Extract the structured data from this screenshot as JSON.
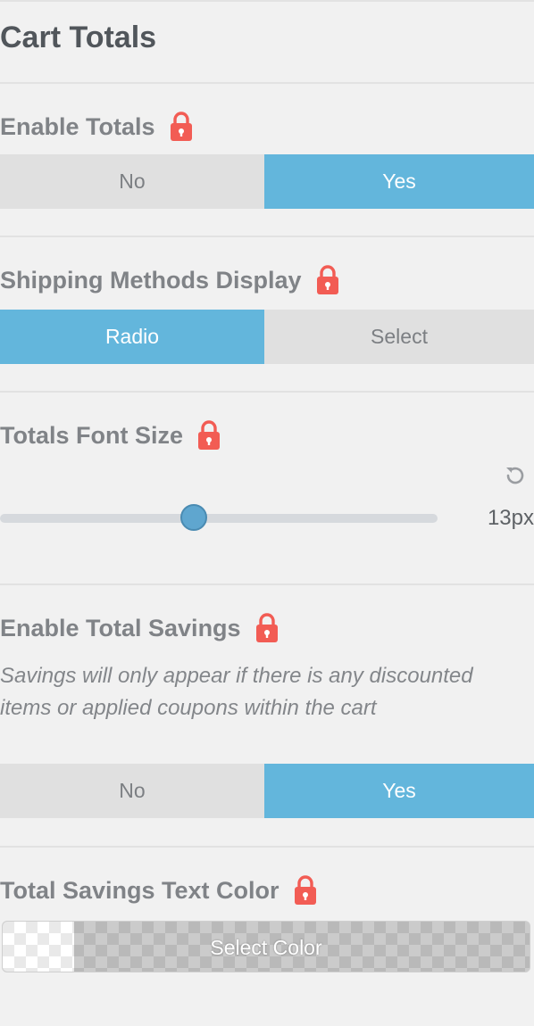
{
  "panel": {
    "title": "Cart Totals"
  },
  "colors": {
    "active": "#63b6dc",
    "inactive": "#e0e0e0",
    "lock": "#f25c54",
    "slider_thumb": "#5fa6cf"
  },
  "controls": {
    "enable_totals": {
      "label": "Enable Totals",
      "locked": true,
      "lock_icon": "lock-icon",
      "options": [
        "No",
        "Yes"
      ],
      "selected": "Yes"
    },
    "shipping_methods_display": {
      "label": "Shipping Methods Display",
      "locked": true,
      "lock_icon": "lock-icon",
      "options": [
        "Radio",
        "Select"
      ],
      "selected": "Radio"
    },
    "totals_font_size": {
      "label": "Totals Font Size",
      "locked": true,
      "lock_icon": "lock-icon",
      "reset_icon": "reset-icon",
      "value": 13,
      "value_display": "13px"
    },
    "enable_total_savings": {
      "label": "Enable Total Savings",
      "locked": true,
      "lock_icon": "lock-icon",
      "description": "Savings will only appear if there is any discounted items or applied coupons within the cart",
      "options": [
        "No",
        "Yes"
      ],
      "selected": "Yes"
    },
    "total_savings_text_color": {
      "label": "Total Savings Text Color",
      "locked": true,
      "lock_icon": "lock-icon",
      "button_label": "Select Color"
    }
  }
}
